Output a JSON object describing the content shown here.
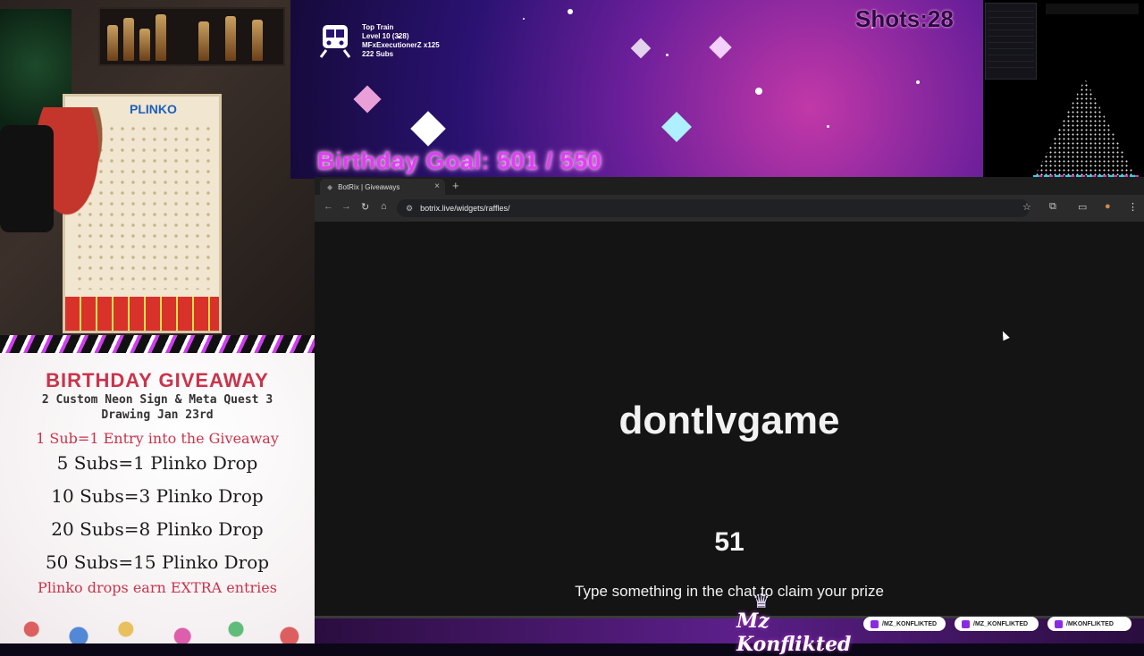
{
  "stream": {
    "train": {
      "icon": "train-icon",
      "title": "Top Train",
      "level": "Level 10 (328)",
      "top_user": "MFxExecutionerZ x125",
      "subs": "222 Subs"
    },
    "goal_text": "Birthday Goal: 501 / 550",
    "shots_text": "Shots:28",
    "giveaway": {
      "title": "BIRTHDAY GIVEAWAY",
      "subtitle_1": "2 Custom Neon Sign & Meta Quest 3",
      "subtitle_2": "Drawing Jan 23rd",
      "line_entry": "1 Sub=1 Entry into the Giveaway",
      "tiers": [
        "5 Subs=1 Plinko Drop",
        "10 Subs=3 Plinko Drop",
        "20 Subs=8 Plinko Drop",
        "50 Subs=15 Plinko Drop"
      ],
      "footer": "Plinko drops earn EXTRA entries"
    },
    "brand": "Mz Konflikted",
    "socials": [
      "/MZ_KONFLIKTED",
      "/MZ_KONFLIKTED",
      "/MKONFLIKTED"
    ],
    "colors": {
      "goal": "#e23df4",
      "giveaway_red": "#c9344b",
      "accent_purple": "#8a2be2"
    }
  },
  "browser": {
    "tab_title": "BotRix | Giveaways",
    "url": "botrix.live/widgets/raffles/",
    "winner_name": "dontlvgame",
    "countdown": "51",
    "claim_message": "Type something in the chat to claim your prize"
  },
  "icons": [
    "train-icon",
    "back-icon",
    "forward-icon",
    "reload-icon",
    "home-icon",
    "site-info-icon",
    "star-icon",
    "extensions-icon",
    "sidepanel-icon",
    "profile-icon",
    "menu-icon",
    "close-icon",
    "plus-icon",
    "cursor-icon",
    "crown-icon"
  ]
}
